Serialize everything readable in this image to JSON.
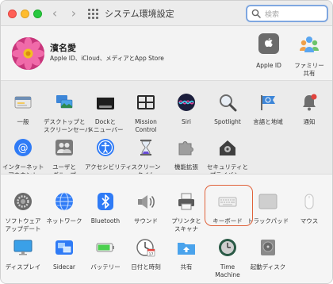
{
  "window": {
    "title": "システム環境設定"
  },
  "search": {
    "placeholder": "検索"
  },
  "account": {
    "name": "濱名愛",
    "subtitle": "Apple ID、iCloud、メディアとApp Store",
    "apple_id_label": "Apple ID",
    "family_label_1": "ファミリー",
    "family_label_2": "共有"
  },
  "row1": [
    {
      "l1": "一般",
      "l2": ""
    },
    {
      "l1": "デスクトップと",
      "l2": "スクリーンセーバ"
    },
    {
      "l1": "Dockと",
      "l2": "メニューバー"
    },
    {
      "l1": "Mission",
      "l2": "Control"
    },
    {
      "l1": "Siri",
      "l2": ""
    },
    {
      "l1": "Spotlight",
      "l2": ""
    },
    {
      "l1": "言語と地域",
      "l2": ""
    },
    {
      "l1": "通知",
      "l2": ""
    }
  ],
  "row2": [
    {
      "l1": "インターネット",
      "l2": "アカウント"
    },
    {
      "l1": "ユーザと",
      "l2": "グループ"
    },
    {
      "l1": "アクセシビリティ",
      "l2": ""
    },
    {
      "l1": "スクリーン",
      "l2": "タイム"
    },
    {
      "l1": "機能拡張",
      "l2": ""
    },
    {
      "l1": "セキュリティと",
      "l2": "プライバシー"
    }
  ],
  "row3": [
    {
      "l1": "ソフトウェア",
      "l2": "アップデート"
    },
    {
      "l1": "ネットワーク",
      "l2": ""
    },
    {
      "l1": "Bluetooth",
      "l2": ""
    },
    {
      "l1": "サウンド",
      "l2": ""
    },
    {
      "l1": "プリンタと",
      "l2": "スキャナ"
    },
    {
      "l1": "キーボード",
      "l2": ""
    },
    {
      "l1": "トラックパッド",
      "l2": ""
    },
    {
      "l1": "マウス",
      "l2": ""
    }
  ],
  "row4": [
    {
      "l1": "ディスプレイ",
      "l2": ""
    },
    {
      "l1": "Sidecar",
      "l2": ""
    },
    {
      "l1": "バッテリー",
      "l2": ""
    },
    {
      "l1": "日付と時刻",
      "l2": ""
    },
    {
      "l1": "共有",
      "l2": ""
    },
    {
      "l1": "Time",
      "l2": "Machine"
    },
    {
      "l1": "起動ディスク",
      "l2": ""
    }
  ],
  "colors": {
    "accent": "#2f7bf6",
    "highlight_border": "#e0633c"
  }
}
